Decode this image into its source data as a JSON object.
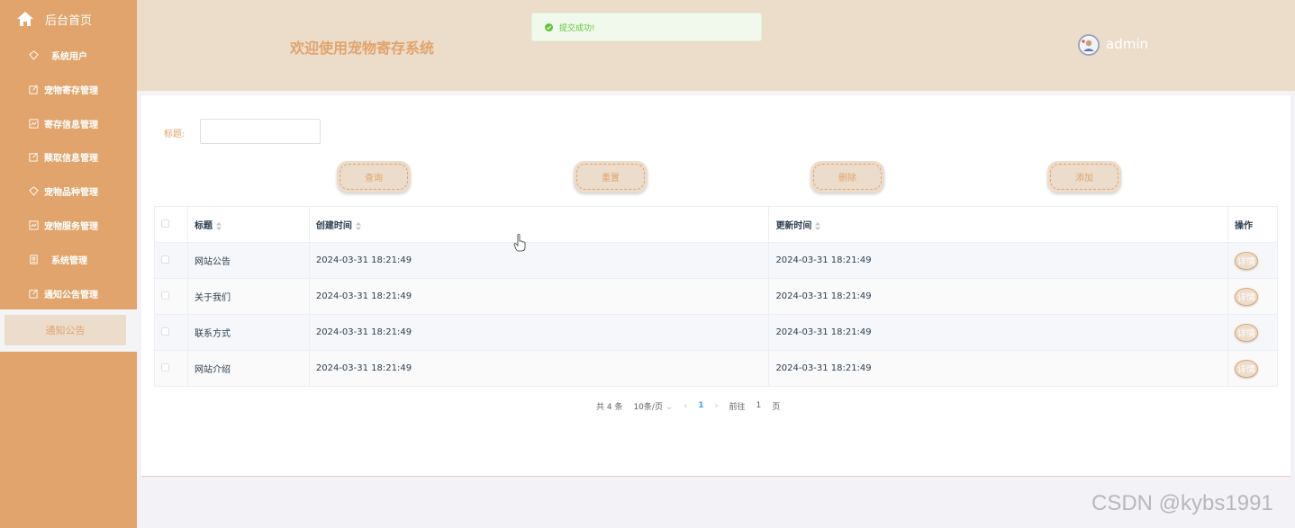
{
  "sidebar": {
    "home_label": "后台首页",
    "items": [
      {
        "label": "系统用户",
        "icon": "diamond-icon"
      },
      {
        "label": "宠物寄存管理",
        "icon": "edit-icon"
      },
      {
        "label": "寄存信息管理",
        "icon": "chart-icon"
      },
      {
        "label": "赎取信息管理",
        "icon": "edit-icon"
      },
      {
        "label": "宠物品种管理",
        "icon": "diamond-icon"
      },
      {
        "label": "宠物服务管理",
        "icon": "chart-icon"
      },
      {
        "label": "系统管理",
        "icon": "badge-icon"
      },
      {
        "label": "通知公告管理",
        "icon": "edit-icon"
      }
    ],
    "active_sub": "通知公告"
  },
  "header": {
    "title": "欢迎使用宠物寄存系统",
    "toast": "提交成功!",
    "username": "admin"
  },
  "search": {
    "label": "标题:",
    "value": ""
  },
  "buttons": {
    "query": "查询",
    "reset": "重置",
    "delete": "删除",
    "add": "添加"
  },
  "table": {
    "headers": [
      "标题",
      "创建时间",
      "更新时间",
      "操作"
    ],
    "rows": [
      {
        "title": "网站公告",
        "created": "2024-03-31 18:21:49",
        "updated": "2024-03-31 18:21:49",
        "action": "详情"
      },
      {
        "title": "关于我们",
        "created": "2024-03-31 18:21:49",
        "updated": "2024-03-31 18:21:49",
        "action": "详情"
      },
      {
        "title": "联系方式",
        "created": "2024-03-31 18:21:49",
        "updated": "2024-03-31 18:21:49",
        "action": "详情"
      },
      {
        "title": "网站介绍",
        "created": "2024-03-31 18:21:49",
        "updated": "2024-03-31 18:21:49",
        "action": "详情"
      }
    ]
  },
  "pagination": {
    "total": "共 4 条",
    "page_size": "10条/页",
    "current": "1",
    "goto_label": "前往",
    "goto_value": "1",
    "page_suffix": "页"
  },
  "watermark": "CSDN @kybs1991",
  "colors": {
    "sidebar": "#e0a46c",
    "header": "#ecdcca",
    "accent": "#e0a46c",
    "success": "#67c23a"
  }
}
